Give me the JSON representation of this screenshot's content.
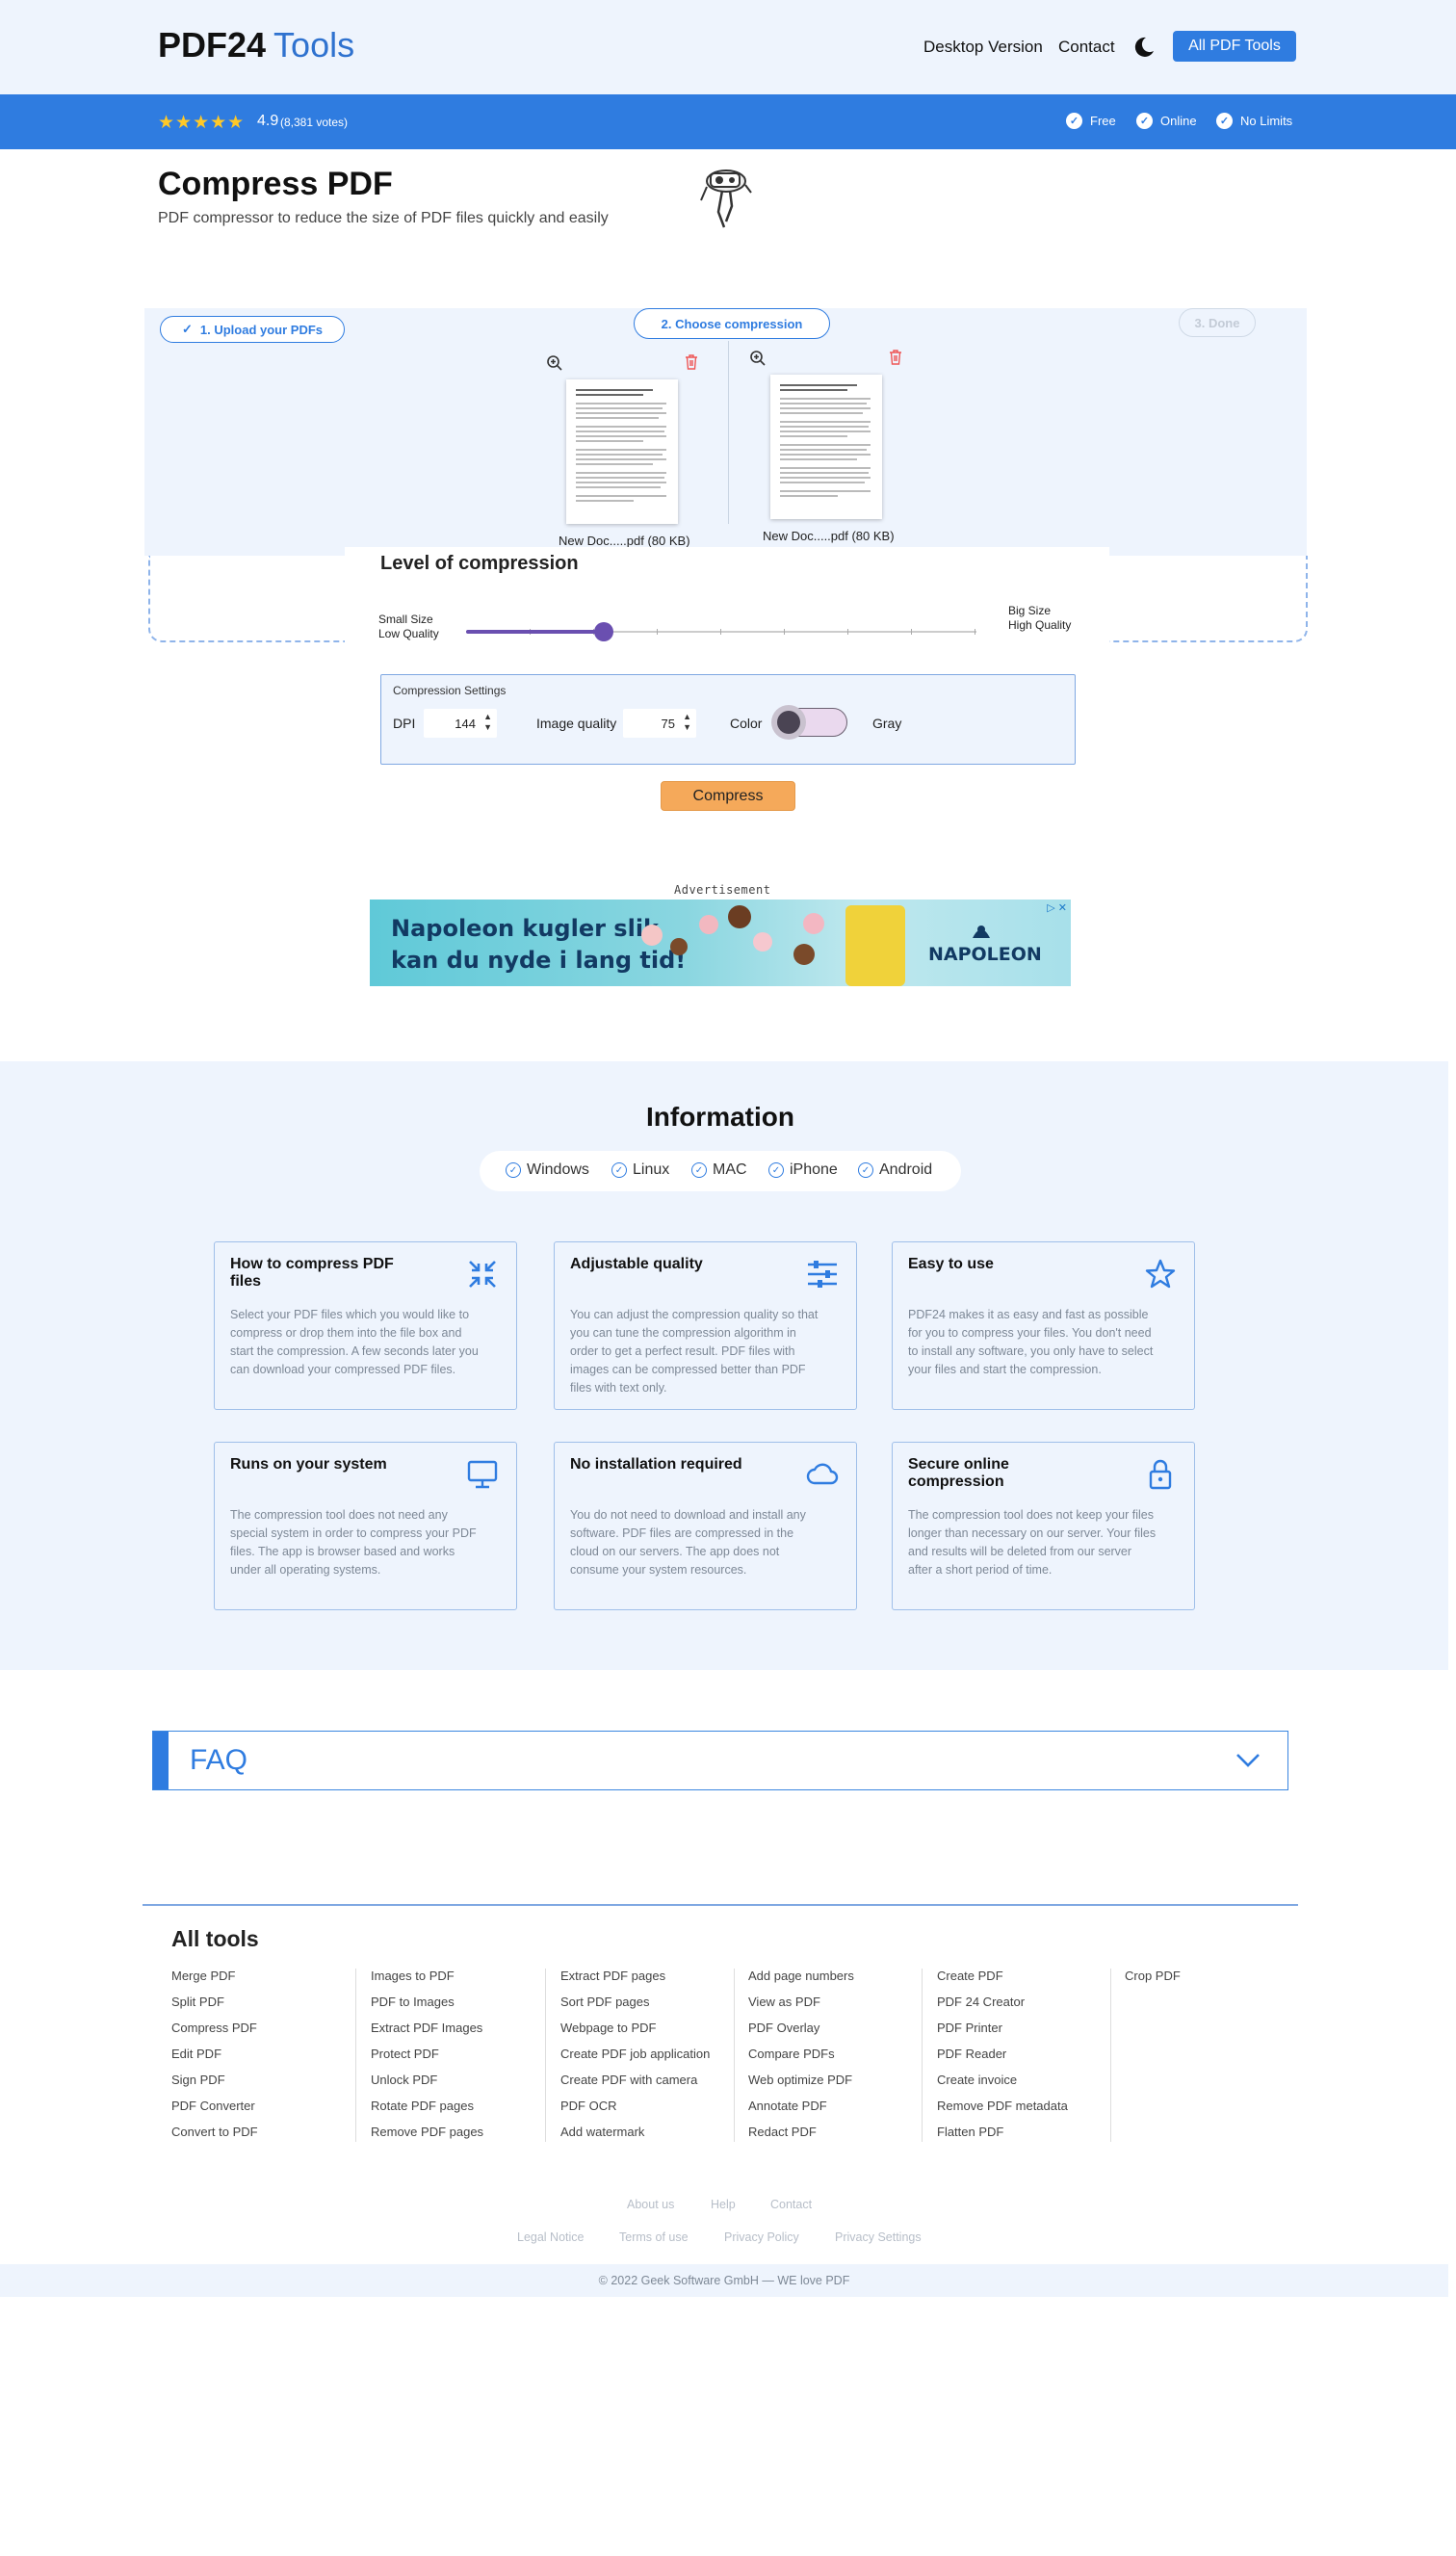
{
  "header": {
    "logo_main": "PDF24",
    "logo_tools": "Tools",
    "nav": [
      "Desktop Version",
      "Contact"
    ],
    "all_tools_label": "All PDF Tools"
  },
  "rating": {
    "stars": "★★★★★",
    "value": "4.9",
    "votes": "(8,381 votes)",
    "features": [
      "Free",
      "Online",
      "No Limits"
    ]
  },
  "page": {
    "title": "Compress PDF",
    "subtitle": "PDF compressor to reduce the size of PDF files quickly and easily"
  },
  "steps": [
    "1. Upload your PDFs",
    "2. Choose compression",
    "3. Done"
  ],
  "files": [
    {
      "name": "New Doc.....pdf (80 KB)"
    },
    {
      "name": "New Doc.....pdf (80 KB)"
    }
  ],
  "compression": {
    "title": "Level of compression",
    "left_label_1": "Small Size",
    "left_label_2": "Low Quality",
    "right_label_1": "Big Size",
    "right_label_2": "High Quality",
    "level": 0.27,
    "settings_title": "Compression Settings",
    "dpi_label": "DPI",
    "dpi_value": "144",
    "quality_label": "Image quality",
    "quality_value": "75",
    "color_label": "Color",
    "gray_label": "Gray",
    "compress_label": "Compress"
  },
  "ad": {
    "label": "Advertisement",
    "line1": "Napoleon kugler slik",
    "line2": "kan du nyde i lang tid!",
    "brand": "NAPOLEON",
    "close_glyph": "▷ ✕"
  },
  "info": {
    "title": "Information",
    "os": [
      "Windows",
      "Linux",
      "MAC",
      "iPhone",
      "Android"
    ],
    "cards": [
      {
        "title": "How to compress PDF files",
        "text": "Select your PDF files which you would like to compress or drop them into the file box and start the compression. A few seconds later you can download your compressed PDF files.",
        "icon": "compress-icon"
      },
      {
        "title": "Adjustable quality",
        "text": "You can adjust the compression quality so that you can tune the compression algorithm in order to get a perfect result. PDF files with images can be compressed better than PDF files with text only.",
        "icon": "sliders-icon"
      },
      {
        "title": "Easy to use",
        "text": "PDF24 makes it as easy and fast as possible for you to compress your files. You don't need to install any software, you only have to select your files and start the compression.",
        "icon": "star-icon"
      },
      {
        "title": "Runs on your system",
        "text": "The compression tool does not need any special system in order to compress your PDF files. The app is browser based and works under all operating systems.",
        "icon": "monitor-icon"
      },
      {
        "title": "No installation required",
        "text": "You do not need to download and install any software. PDF files are compressed in the cloud on our servers. The app does not consume your system resources.",
        "icon": "cloud-icon"
      },
      {
        "title": "Secure online compression",
        "text": "The compression tool does not keep your files longer than necessary on our server. Your files and results will be deleted from our server after a short period of time.",
        "icon": "lock-icon"
      }
    ]
  },
  "faq": {
    "title": "FAQ"
  },
  "all_tools": {
    "title": "All tools",
    "columns": [
      [
        "Merge PDF",
        "Split PDF",
        "Compress PDF",
        "Edit PDF",
        "Sign PDF",
        "PDF Converter",
        "Convert to PDF"
      ],
      [
        "Images to PDF",
        "PDF to Images",
        "Extract PDF Images",
        "Protect PDF",
        "Unlock PDF",
        "Rotate PDF pages",
        "Remove PDF pages"
      ],
      [
        "Extract PDF pages",
        "Sort PDF pages",
        "Webpage to PDF",
        "Create PDF job application",
        "Create PDF with camera",
        "PDF OCR",
        "Add watermark"
      ],
      [
        "Add page numbers",
        "View as PDF",
        "PDF Overlay",
        "Compare PDFs",
        "Web optimize PDF",
        "Annotate PDF",
        "Redact PDF"
      ],
      [
        "Create PDF",
        "PDF 24 Creator",
        "PDF Printer",
        "PDF Reader",
        "Create invoice",
        "Remove PDF metadata",
        "Flatten PDF"
      ],
      [
        "Crop PDF"
      ]
    ]
  },
  "footer": {
    "links_row1": [
      "About us",
      "Help",
      "Contact"
    ],
    "links_row2": [
      "Legal Notice",
      "Terms of use",
      "Privacy Policy",
      "Privacy Settings"
    ],
    "copyright": "© 2022 Geek Software GmbH — WE love PDF"
  },
  "colors": {
    "accent": "#2f7ce0",
    "slider": "#6a4fb0",
    "compress_button": "#f5a95a"
  }
}
